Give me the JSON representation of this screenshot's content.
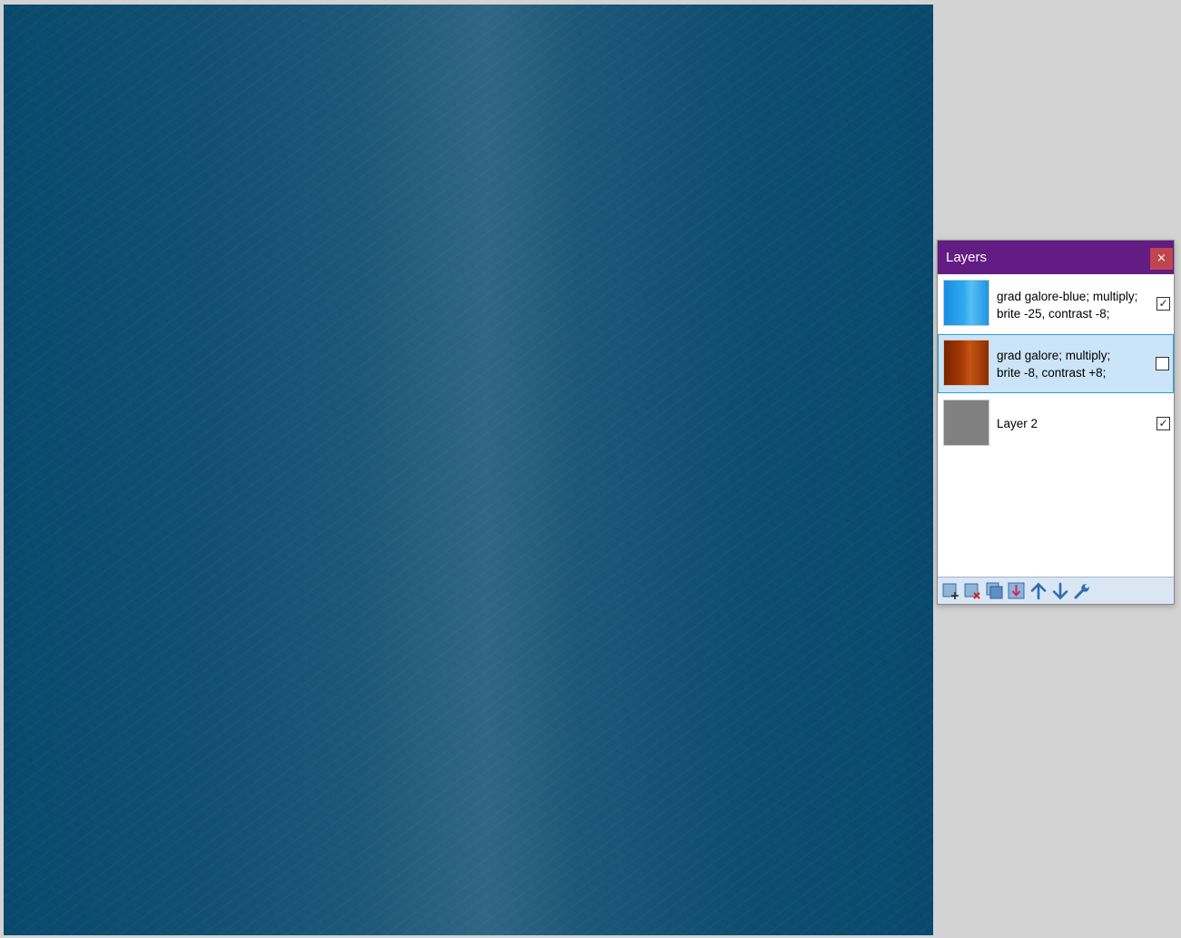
{
  "panel": {
    "title": "Layers",
    "close_label": "×"
  },
  "layers": [
    {
      "name_line1": "grad galore-blue; multiply;",
      "name_line2": "brite -25, contrast -8;",
      "visible": true,
      "selected": false,
      "check_mark": "✓"
    },
    {
      "name_line1": "grad galore; multiply;",
      "name_line2": "brite -8, contrast +8;",
      "visible": false,
      "selected": true,
      "check_mark": ""
    },
    {
      "name_line1": "Layer 2",
      "name_line2": "",
      "visible": true,
      "selected": false,
      "check_mark": "✓"
    }
  ],
  "toolbar": {
    "buttons": [
      {
        "icon": "add-layer-icon"
      },
      {
        "icon": "delete-layer-icon"
      },
      {
        "icon": "duplicate-layer-icon"
      },
      {
        "icon": "merge-layer-down-icon"
      },
      {
        "icon": "move-layer-up-icon"
      },
      {
        "icon": "move-layer-down-icon"
      },
      {
        "icon": "layer-properties-icon"
      }
    ]
  },
  "colors": {
    "titlebar": "#621c84",
    "close_button": "#c0454f",
    "selection": "#cce4f7",
    "canvas": "#094a6e"
  }
}
